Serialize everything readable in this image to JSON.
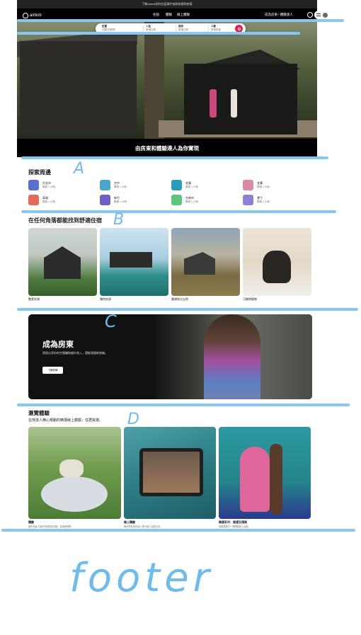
{
  "announcement": "了解Airbnb如何在疫情中協助房客和房東",
  "nav": {
    "brand": "airbnb",
    "links": [
      "住宿",
      "體驗",
      "線上體驗"
    ],
    "host_link": "成為房東 / 體驗達人"
  },
  "search": {
    "fields": [
      {
        "label": "位置",
        "value": "你要去哪裡？"
      },
      {
        "label": "入住",
        "value": "新增日期"
      },
      {
        "label": "退房",
        "value": "新增日期"
      },
      {
        "label": "人數",
        "value": "新增房客"
      }
    ]
  },
  "hero": {
    "caption": "由房東和體驗達人為你實現"
  },
  "explore": {
    "title": "探索周邊",
    "places": [
      {
        "name": "台北市",
        "distance": "車程 1 小時",
        "color": "#5b6fd0"
      },
      {
        "name": "台中",
        "distance": "車程 1 小時",
        "color": "#4aa6c8"
      },
      {
        "name": "花蓮",
        "distance": "車程 1 小時",
        "color": "#2a9cb7"
      },
      {
        "name": "宜蘭",
        "distance": "車程 1 小時",
        "color": "#d98aa6"
      },
      {
        "name": "高雄",
        "distance": "車程 1 小時",
        "color": "#e46a5a"
      },
      {
        "name": "新竹",
        "distance": "車程 1 小時",
        "color": "#6f60c6"
      },
      {
        "name": "台南市",
        "distance": "車程 1 小時",
        "color": "#5cc47d"
      },
      {
        "name": "墾丁",
        "distance": "車程 1 小時",
        "color": "#8f7fd6"
      }
    ]
  },
  "anywhere": {
    "title": "在任何角落都能找到舒適住宿",
    "stays": [
      {
        "label": "整套房源"
      },
      {
        "label": "獨特房源"
      },
      {
        "label": "農場和大自然"
      },
      {
        "label": "可攜帶寵物"
      }
    ]
  },
  "host_card": {
    "title": "成為房東",
    "description": "透過分享你的空間賺取額外收入，還能發掘新商機。",
    "button": "了解詳情"
  },
  "experiences": {
    "title": "瀏覽體驗",
    "subtitle": "在地達人精心規劃的精選線上體驗，任君挑選。",
    "items": [
      {
        "label": "體驗",
        "desc": "與在地達人結伴完成精彩活動，探索新視野。"
      },
      {
        "label": "線上體驗",
        "desc": "與世界各地的達人進行線上互動交流。"
      },
      {
        "label": "精選系列：奧運及殘奧",
        "desc": "與奧運選手一同體驗線上活動。"
      }
    ]
  },
  "annotations": {
    "marks": [
      "A",
      "B",
      "C",
      "D"
    ],
    "footer": "footer",
    "color": "#86c8f2"
  }
}
